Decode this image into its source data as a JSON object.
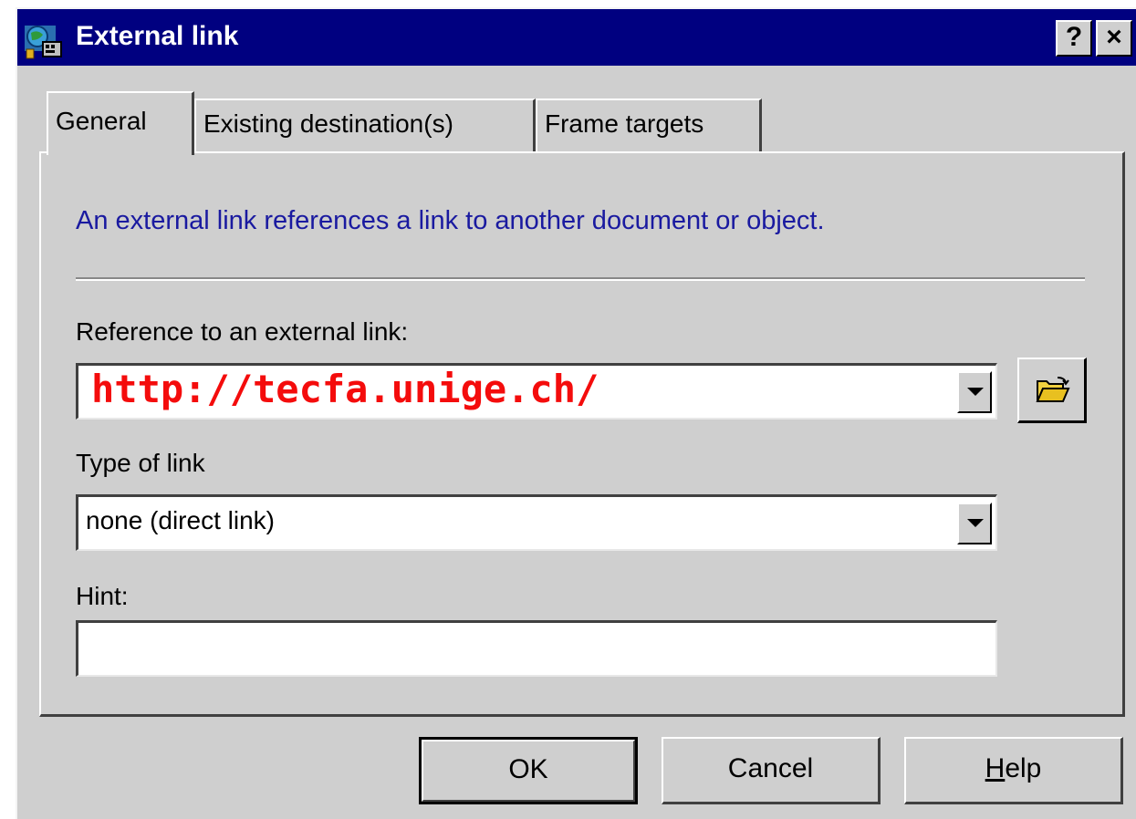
{
  "window": {
    "title": "External link",
    "help_label": "?",
    "close_label": "×"
  },
  "tabs": [
    {
      "label": "General",
      "active": true
    },
    {
      "label": "Existing destination(s)",
      "active": false
    },
    {
      "label": "Frame targets",
      "active": false
    }
  ],
  "general": {
    "info": "An external link references a link to another document or object.",
    "reference_label": "Reference to an external link:",
    "reference_value": "http://tecfa.unige.ch/",
    "type_label": "Type of link",
    "type_value": "none (direct link)",
    "hint_label": "Hint:",
    "hint_value": ""
  },
  "buttons": {
    "ok": "OK",
    "cancel": "Cancel",
    "help_accel": "H",
    "help_rest": "elp"
  },
  "colors": {
    "titlebar": "#000080",
    "face": "#cfcfcf",
    "info_text": "#1a1aa0",
    "url_text": "#f40c0c"
  },
  "icons": {
    "app": "app-icon",
    "browse": "open-folder-icon",
    "dropdown": "chevron-down-icon"
  }
}
